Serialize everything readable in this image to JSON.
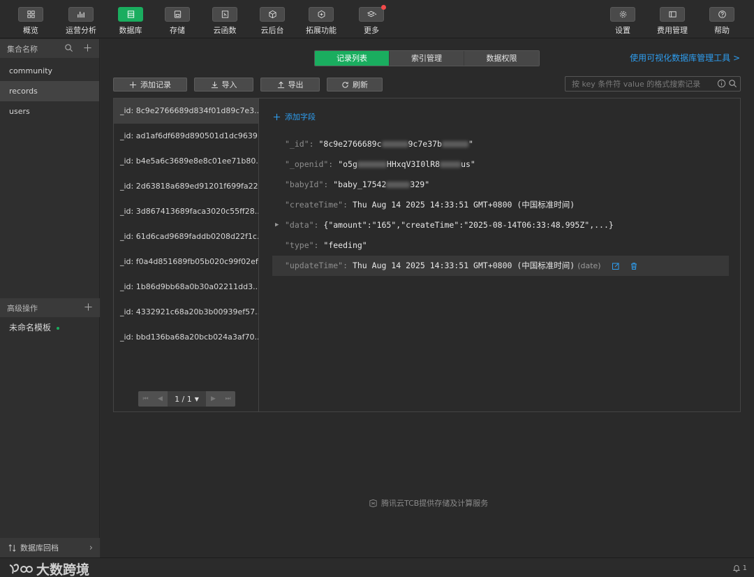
{
  "toolbar": {
    "left": [
      {
        "label": "概览",
        "icon": "grid-icon"
      },
      {
        "label": "运营分析",
        "icon": "bar-chart-icon"
      },
      {
        "label": "数据库",
        "icon": "database-icon"
      },
      {
        "label": "存储",
        "icon": "storage-icon"
      },
      {
        "label": "云函数",
        "icon": "function-icon"
      },
      {
        "label": "云后台",
        "icon": "cube-icon"
      },
      {
        "label": "拓展功能",
        "icon": "extension-icon"
      },
      {
        "label": "更多",
        "icon": "layers-icon"
      }
    ],
    "right": [
      {
        "label": "设置",
        "icon": "gear-icon"
      },
      {
        "label": "费用管理",
        "icon": "billing-icon"
      },
      {
        "label": "帮助",
        "icon": "help-icon"
      }
    ],
    "accent": "#1aad5f"
  },
  "sidebar": {
    "collections_title": "集合名称",
    "collections": [
      "community",
      "records",
      "users"
    ],
    "advanced_title": "高级操作",
    "template": "未命名模板",
    "footer": "数据库回档"
  },
  "main": {
    "tabs": [
      "记录列表",
      "索引管理",
      "数据权限"
    ],
    "visual_link": "使用可视化数据库管理工具 >",
    "buttons": {
      "add": "添加记录",
      "import": "导入",
      "export": "导出",
      "refresh": "刷新"
    },
    "search_placeholder": "按 key 条件符 value 的格式搜索记录",
    "records": [
      "_id: 8c9e2766689d834f01d89c7e3...",
      "_id: ad1af6df689d890501d1dc9639...",
      "_id: b4e5a6c3689e8e8c01ee71b80...",
      "_id: 2d63818a689ed91201f699fa22...",
      "_id: 3d867413689faca3020c55ff28...",
      "_id: 61d6cad9689faddb0208d22f1c...",
      "_id: f0a4d851689fb05b020c99f02ef...",
      "_id: 1b86d9bb68a0b30a02211dd3...",
      "_id: 4332921c68a20b3b00939ef57...",
      "_id: bbd136ba68a20bcb024a3af70..."
    ],
    "pager": "1 / 1",
    "add_field": "添加字段",
    "fields": {
      "id_key": "\"_id\":",
      "id_v1": "\"8c9e2766689c",
      "id_v2": "9c7e37b",
      "id_v3": "\"",
      "openid_key": "\"_openid\":",
      "openid_v1": "\"o5g",
      "openid_v2": "HHxqV3I0lR8",
      "openid_v3": "us\"",
      "babyid_key": "\"babyId\":",
      "babyid_v1": "\"baby_17542",
      "babyid_v2": "329\"",
      "createtime_key": "\"createTime\":",
      "createtime_val": "Thu Aug 14 2025 14:33:51 GMT+0800 (中国标准时间)",
      "data_key": "\"data\":",
      "data_val": "{\"amount\":\"165\",\"createTime\":\"2025-08-14T06:33:48.995Z\",...}",
      "type_key": "\"type\":",
      "type_val": "\"feeding\"",
      "updatetime_key": "\"updateTime\":",
      "updatetime_val": "Thu Aug 14 2025 14:33:51 GMT+0800 (中国标准时间)",
      "updatetime_type": "(date)"
    },
    "footer": "腾讯云TCB提供存储及计算服务"
  },
  "statusbar": {
    "watermark": "大数跨境",
    "notifications": "1"
  }
}
